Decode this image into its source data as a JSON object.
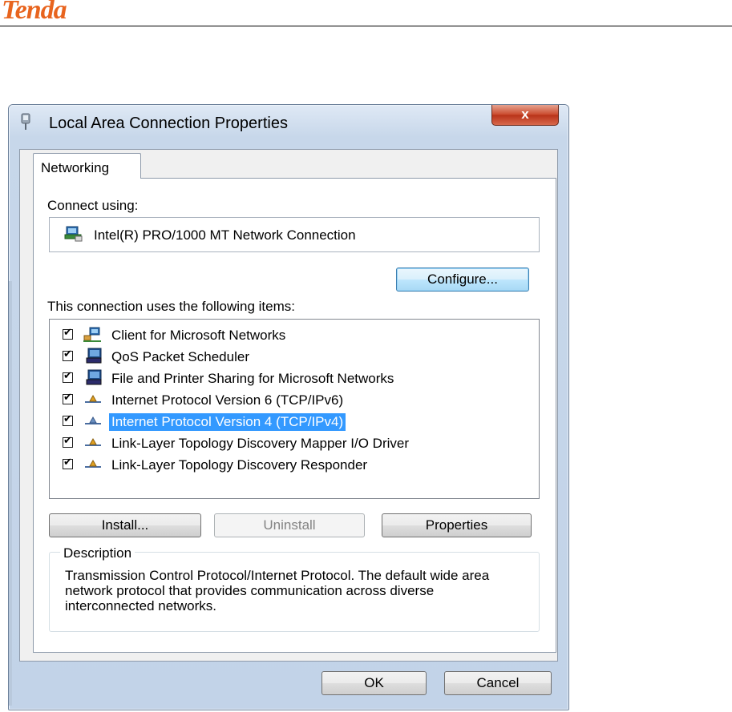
{
  "page": {
    "logo_text": "Tenda"
  },
  "dialog": {
    "title": "Local Area Connection Properties",
    "close_glyph": "x",
    "tab_label": "Networking",
    "connect_using_label": "Connect using:",
    "adapter_name": "Intel(R) PRO/1000 MT Network Connection",
    "configure_label": "Configure...",
    "items_heading": "This connection uses the following items:",
    "items": [
      {
        "label": "Client for Microsoft Networks",
        "checked": true,
        "icon": "network-client-icon"
      },
      {
        "label": "QoS Packet Scheduler",
        "checked": true,
        "icon": "network-service-icon"
      },
      {
        "label": "File and Printer Sharing for Microsoft Networks",
        "checked": true,
        "icon": "network-service-icon"
      },
      {
        "label": "Internet Protocol Version 6 (TCP/IPv6)",
        "checked": true,
        "icon": "protocol-icon"
      },
      {
        "label": "Internet Protocol Version 4 (TCP/IPv4)",
        "checked": true,
        "icon": "protocol-icon",
        "selected": true
      },
      {
        "label": "Link-Layer Topology Discovery Mapper I/O Driver",
        "checked": true,
        "icon": "protocol-icon"
      },
      {
        "label": "Link-Layer Topology Discovery Responder",
        "checked": true,
        "icon": "protocol-icon"
      }
    ],
    "install_label": "Install...",
    "uninstall_label": "Uninstall",
    "properties_label": "Properties",
    "description_legend": "Description",
    "description_text": "Transmission Control Protocol/Internet Protocol. The default wide area network protocol that provides communication across diverse interconnected networks.",
    "ok_label": "OK",
    "cancel_label": "Cancel"
  },
  "colors": {
    "logo": "#e8641e",
    "selection": "#3399ff",
    "close_button": "#c9482b",
    "window_frame": "#c2d3e8"
  }
}
